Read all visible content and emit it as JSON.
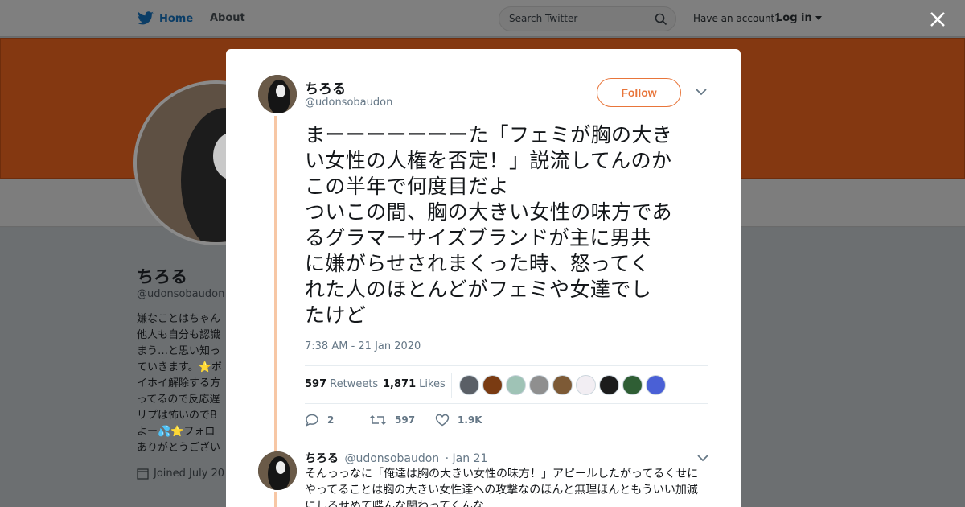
{
  "topbar": {
    "home_label": "Home",
    "about_label": "About",
    "search_placeholder": "Search Twitter",
    "have_account": "Have an account?",
    "login_label": "Log in"
  },
  "profile": {
    "name": "ちろる",
    "handle": "@udonsobaudon",
    "bio_lines": [
      "嫌なことはちゃん",
      "他人も自分も認識",
      "まう…と思い知っ",
      "ていきます。⭐ボ",
      "イホイ解除する方",
      "ってるので反応遅",
      "リプは怖いのでB",
      "よー💦⭐フォロ",
      "ありがとうござい"
    ],
    "joined": "Joined July 20"
  },
  "tweet": {
    "name": "ちろる",
    "handle": "@udonsobaudon",
    "follow_label": "Follow",
    "text_lines": [
      "まーーーーーーーた「フェミが胸の大き",
      "い女性の人権を否定！」説流してんのか",
      "この半年で何度目だよ",
      "ついこの間、胸の大きい女性の味方であ",
      "るグラマーサイズブランドが主に男共",
      "に嫌がらせされまくった時、怒ってく",
      "れた人のほとんどがフェミや女達でし",
      "たけど"
    ],
    "timestamp": "7:38 AM - 21 Jan 2020",
    "retweets_count": "597",
    "retweets_label": "Retweets",
    "likes_count": "1,871",
    "likes_label": "Likes",
    "liker_colors": [
      "#5a5f66",
      "#7a3b12",
      "#9fc3b6",
      "#8f8f8f",
      "#7d5a36",
      "#f2eef3",
      "#1c1c1c",
      "#2f5e34",
      "#4a60d6"
    ],
    "actions": {
      "reply_count": "2",
      "retweet_count": "597",
      "like_count": "1.9K"
    }
  },
  "reply": {
    "name": "ちろる",
    "handle": "@udonsobaudon",
    "date": "· Jan 21",
    "text_lines": [
      "そんっっなに「俺達は胸の大きい女性の味方！」アピールしたがってるくせに",
      "やってることは胸の大きい女性達への攻撃なのほんと無理ほんともういい加減",
      "にしろせめて喋んな関わってくんな"
    ]
  },
  "colors": {
    "accent": "#e8753a",
    "thread_line": "#f7c7a5",
    "banner": "#843811"
  }
}
